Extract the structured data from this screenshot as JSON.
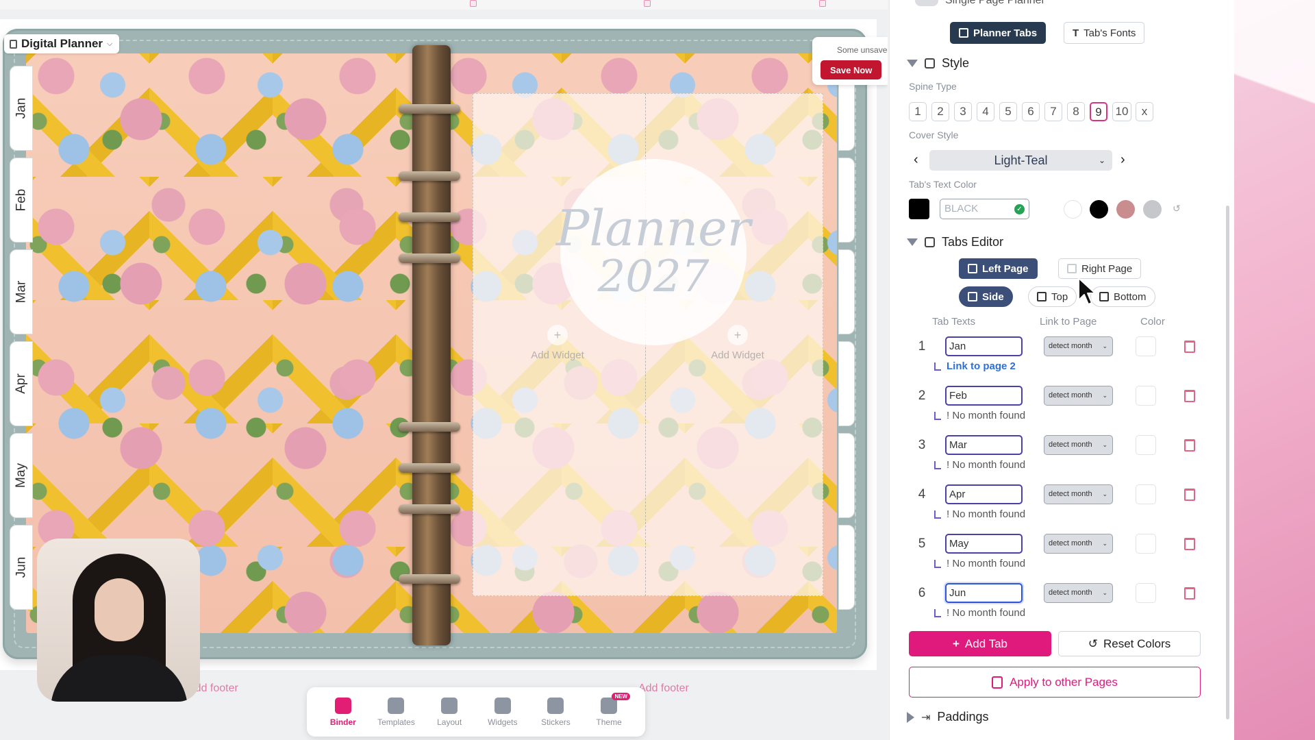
{
  "canvas": {
    "planner_name": "Digital Planner",
    "save_notice": "Some unsaved",
    "save_button": "Save Now",
    "cover_title": "Planner",
    "cover_year": "2027",
    "add_widget": "Add Widget",
    "add_footer_left": "Add footer",
    "add_footer_right": "Add footer",
    "month_tabs": [
      "Jan",
      "Feb",
      "Mar",
      "Apr",
      "May",
      "Jun"
    ]
  },
  "toolbar": {
    "items": [
      {
        "label": "Binder",
        "icon": "binder-icon",
        "active": true
      },
      {
        "label": "Templates",
        "icon": "templates-icon",
        "active": false
      },
      {
        "label": "Layout",
        "icon": "layout-icon",
        "active": false
      },
      {
        "label": "Widgets",
        "icon": "widgets-icon",
        "active": false
      },
      {
        "label": "Stickers",
        "icon": "stickers-icon",
        "active": false
      },
      {
        "label": "Theme",
        "icon": "theme-icon",
        "active": false,
        "badge": "NEW"
      }
    ]
  },
  "sidebar": {
    "top_cut_label": "Single Page Planner",
    "top_tabs": {
      "planner_tabs": "Planner Tabs",
      "tab_fonts": "Tab's Fonts"
    },
    "style": {
      "heading": "Style",
      "spine_type_label": "Spine Type",
      "spine_options": [
        "1",
        "2",
        "3",
        "4",
        "5",
        "6",
        "7",
        "8",
        "9",
        "10",
        "x"
      ],
      "spine_selected": "9",
      "cover_style_label": "Cover Style",
      "cover_style_value": "Light-Teal",
      "text_color_label": "Tab's Text Color",
      "text_color_value": "BLACK",
      "swatches": [
        "#ffffff",
        "#000000",
        "#c98d8f",
        "#c5c7cb"
      ]
    },
    "tabs_editor": {
      "heading": "Tabs Editor",
      "page_left": "Left Page",
      "page_right": "Right Page",
      "pos_side": "Side",
      "pos_top": "Top",
      "pos_bottom": "Bottom",
      "col_tab_texts": "Tab Texts",
      "col_link": "Link to Page",
      "col_color": "Color",
      "rows": [
        {
          "num": "1",
          "text": "Jan",
          "link": "detect month",
          "note": "Link to page 2"
        },
        {
          "num": "2",
          "text": "Feb",
          "link": "detect month",
          "note": "! No month found"
        },
        {
          "num": "3",
          "text": "Mar",
          "link": "detect month",
          "note": "! No month found"
        },
        {
          "num": "4",
          "text": "Apr",
          "link": "detect month",
          "note": "! No month found"
        },
        {
          "num": "5",
          "text": "May",
          "link": "detect month",
          "note": "! No month found"
        },
        {
          "num": "6",
          "text": "Jun",
          "link": "detect month",
          "note": "! No month found"
        }
      ],
      "add_tab": "Add Tab",
      "reset_colors": "Reset Colors",
      "apply_other": "Apply to other Pages"
    },
    "paddings_heading": "Paddings"
  },
  "colors": {
    "accent_pink": "#e0197d",
    "save_red": "#c2152f",
    "dark_navy": "#273a4f",
    "binder_teal": "#9fb4b3"
  }
}
